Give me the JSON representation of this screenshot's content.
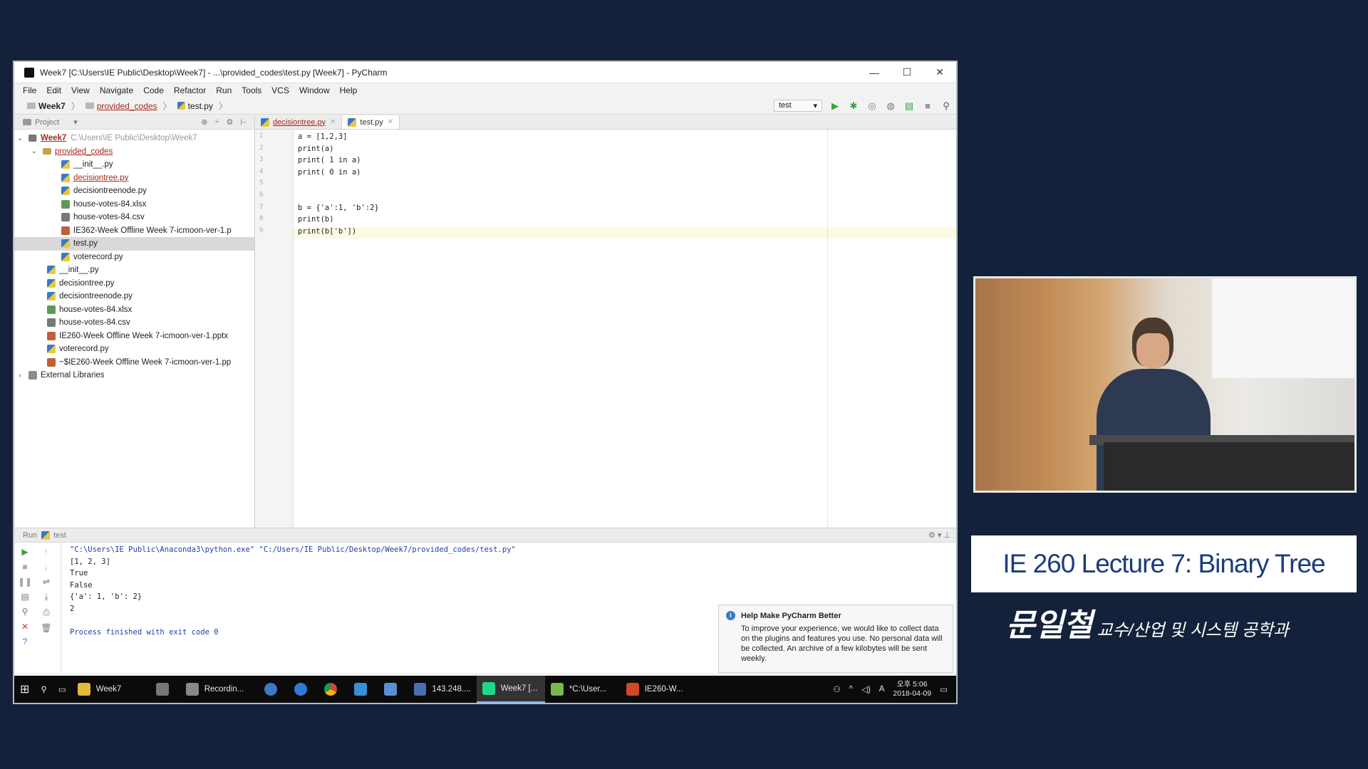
{
  "window": {
    "title": "Week7 [C:\\Users\\IE Public\\Desktop\\Week7] - ...\\provided_codes\\test.py [Week7] - PyCharm",
    "controls": [
      "—",
      "☐",
      "✕"
    ]
  },
  "menu": [
    "File",
    "Edit",
    "View",
    "Navigate",
    "Code",
    "Refactor",
    "Run",
    "Tools",
    "VCS",
    "Window",
    "Help"
  ],
  "breadcrumb": [
    "Week7",
    "provided_codes",
    "test.py"
  ],
  "run_config": "test",
  "project_panel": {
    "label": "Project",
    "root_name": "Week7",
    "root_path": "C:\\Users\\IE Public\\Desktop\\Week7",
    "tree": [
      "provided_codes",
      "__init__.py",
      "decisiontree.py",
      "decisiontreenode.py",
      "house-votes-84.xlsx",
      "house-votes-84.csv",
      "IE362-Week Offline Week 7-icmoon-ver-1.p",
      "test.py",
      "voterecord.py",
      "__init__.py",
      "decisiontree.py",
      "decisiontreenode.py",
      "house-votes-84.xlsx",
      "house-votes-84.csv",
      "IE260-Week Offline Week 7-icmoon-ver-1.pptx",
      "voterecord.py",
      "~$IE260-Week Offline Week 7-icmoon-ver-1.pp",
      "External Libraries"
    ]
  },
  "editor": {
    "tabs": [
      "decisiontree.py",
      "test.py"
    ],
    "line_numbers": [
      "1",
      "2",
      "3",
      "4",
      "5",
      "6",
      "7",
      "8",
      "9"
    ],
    "lines": [
      "a = [1,2,3]",
      "print(a)",
      "print( 1 in a)",
      "print( 0 in a)",
      "",
      "",
      "b = {'a':1, 'b':2}",
      "print(b)",
      "print(b['b'])"
    ]
  },
  "run_panel": {
    "label": "Run",
    "config": "test",
    "output": [
      "\"C:\\Users\\IE Public\\Anaconda3\\python.exe\" \"C:/Users/IE Public/Desktop/Week7/provided_codes/test.py\"",
      "[1, 2, 3]",
      "True",
      "False",
      "{'a': 1, 'b': 2}",
      "2",
      "",
      "Process finished with exit code 0"
    ]
  },
  "notification": {
    "title": "Help Make PyCharm Better",
    "body": "To improve your experience, we would like to collect data on the plugins and features you use. No personal data will be collected. An archive of a few kilobytes will be sent weekly."
  },
  "taskbar": {
    "items": [
      "Week7",
      "Recordin...",
      "143.248....",
      "Week7 [...",
      "*C:\\User...",
      "IE260-W..."
    ],
    "time": "오후 5:06",
    "date": "2018-04-09",
    "ime": "A"
  },
  "caption": {
    "title": "IE 260 Lecture 7: Binary Tree",
    "name": "문일철",
    "role": "교수/산업 및 시스템 공학과"
  },
  "colors": {
    "background": "#13223a",
    "caption_title": "#1a3d7a",
    "run_green": "#3aa23a",
    "console_blue": "#1e3fa8"
  }
}
